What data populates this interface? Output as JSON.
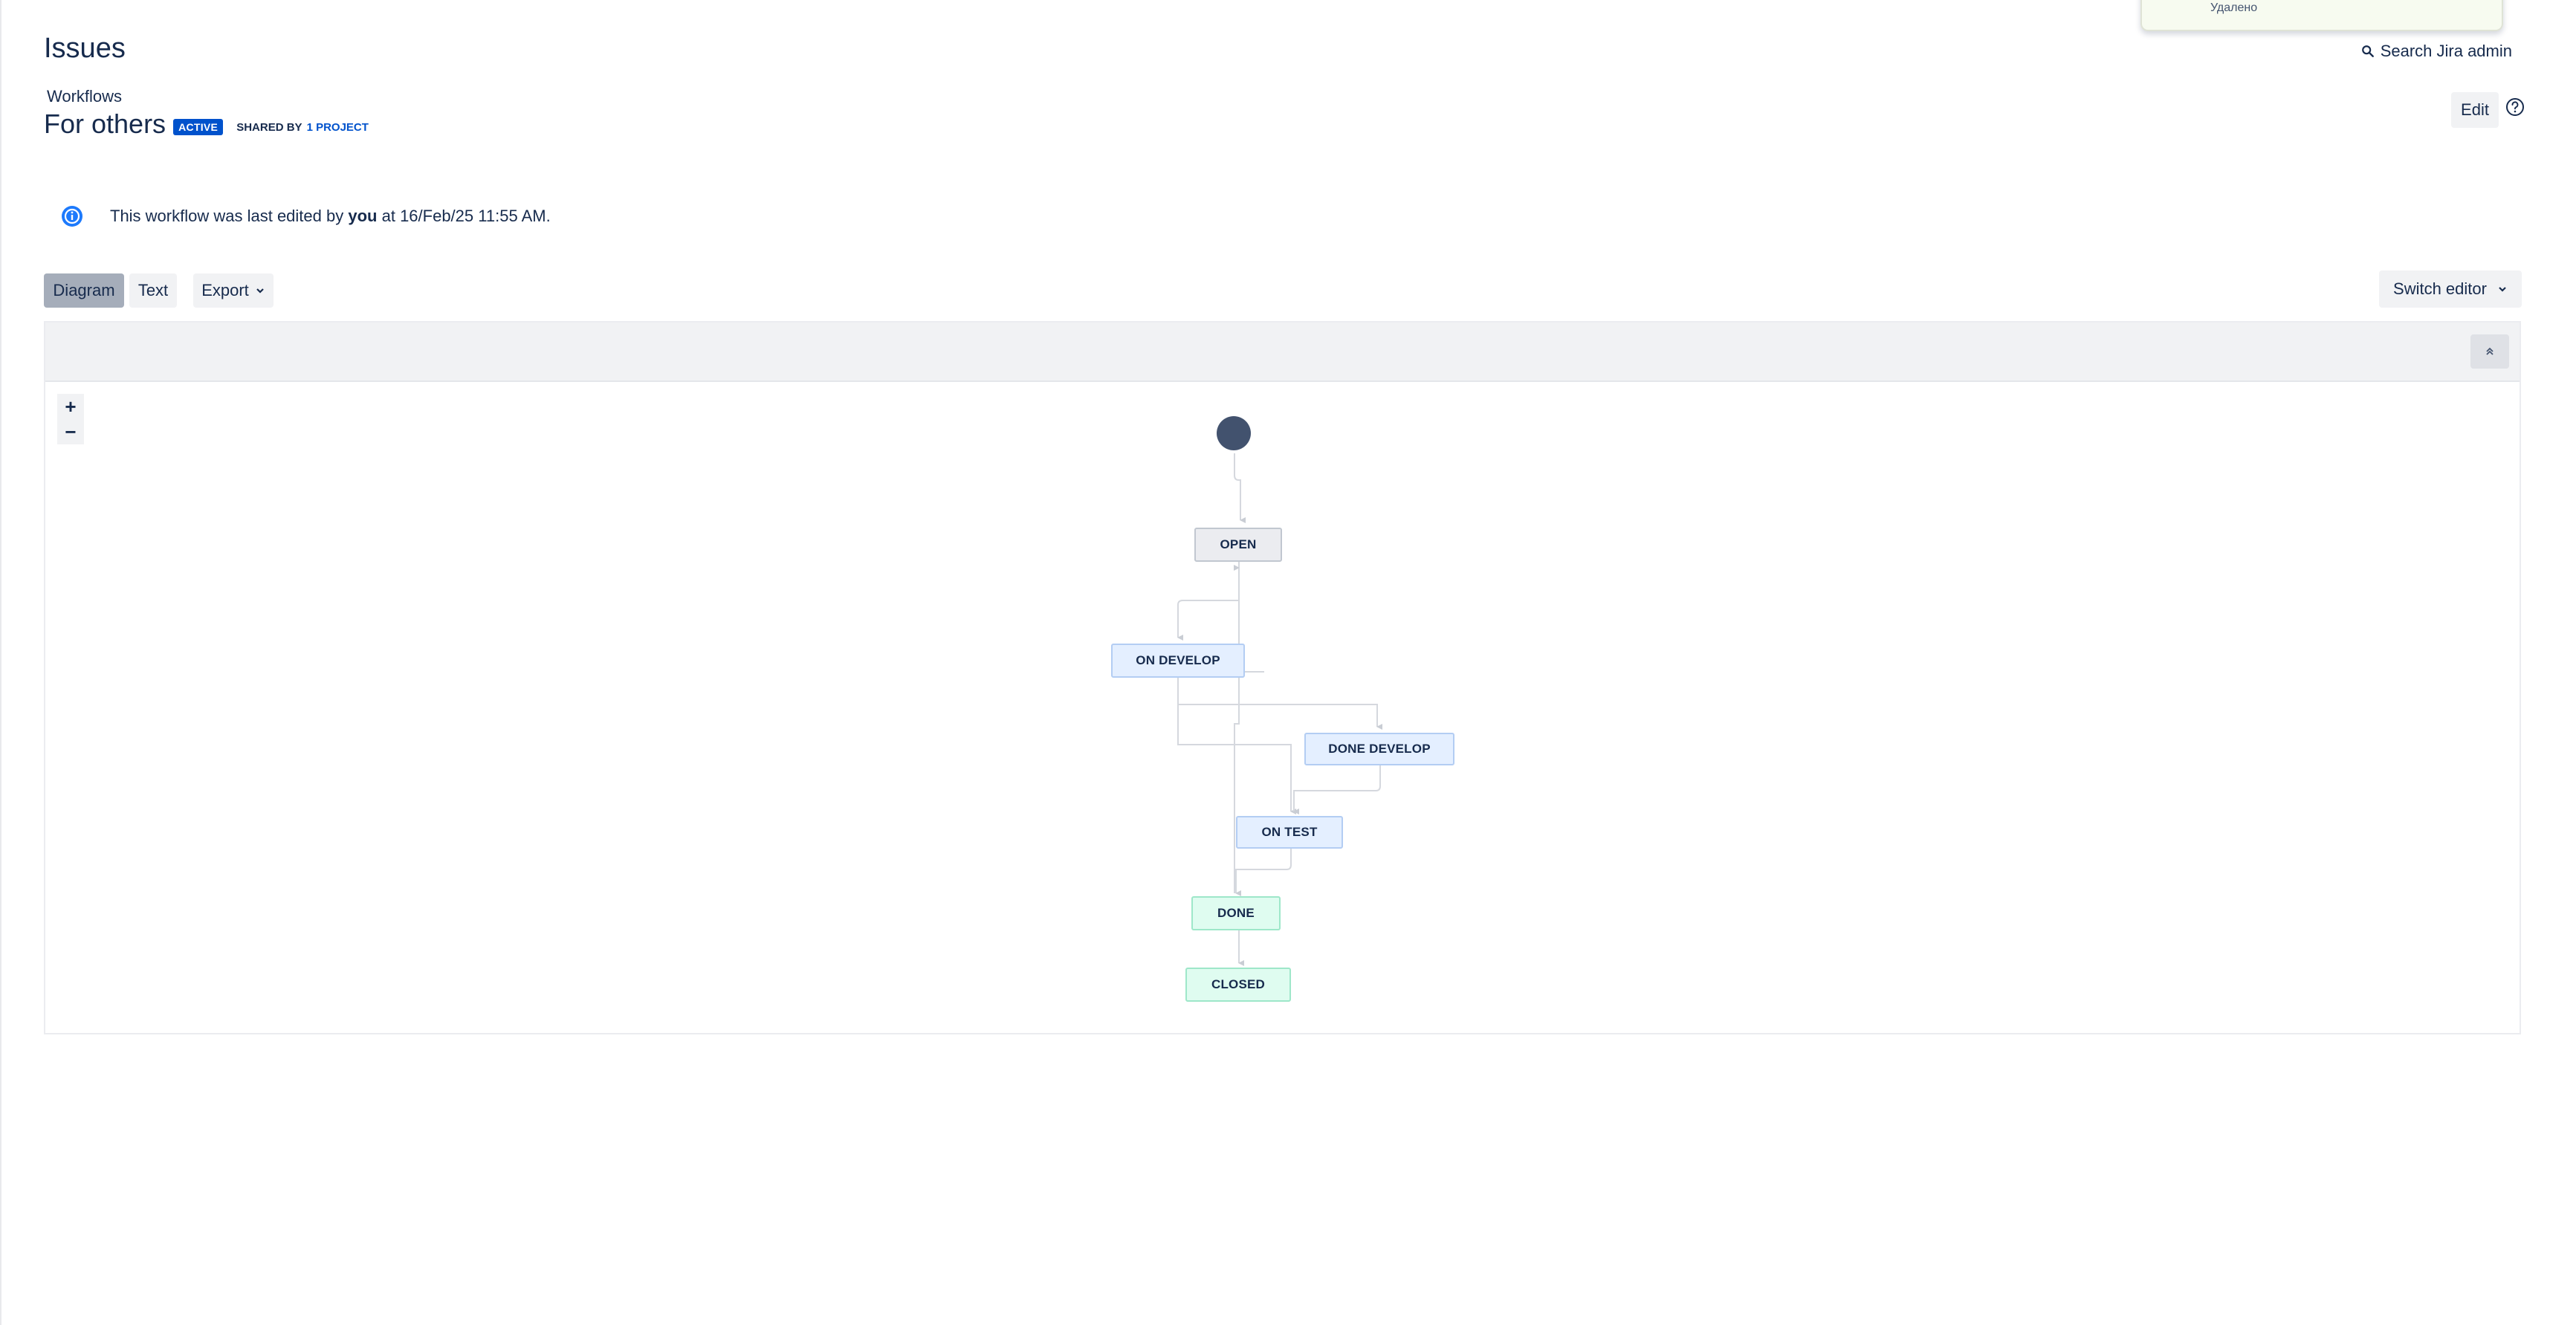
{
  "toast": {
    "text": "Удалено"
  },
  "header": {
    "title": "Issues",
    "search_admin_label": "Search Jira admin"
  },
  "workflow": {
    "breadcrumb": "Workflows",
    "name": "For others",
    "status_lozenge": "ACTIVE",
    "shared_by_label": "SHARED BY",
    "shared_by_link": "1 PROJECT",
    "edit_label": "Edit"
  },
  "info_message": {
    "prefix": "This workflow was last edited by",
    "user": "you",
    "suffix": "at 16/Feb/25 11:55 AM."
  },
  "view_tabs": {
    "diagram": "Diagram",
    "text": "Text",
    "export": "Export",
    "switch_editor": "Switch editor"
  },
  "zoom": {
    "in": "+",
    "out": "−"
  },
  "statuses": [
    {
      "id": "open",
      "label": "OPEN",
      "category": "todo"
    },
    {
      "id": "on_develop",
      "label": "ON DEVELOP",
      "category": "progress"
    },
    {
      "id": "done_develop",
      "label": "DONE DEVELOP",
      "category": "progress"
    },
    {
      "id": "on_test",
      "label": "ON TEST",
      "category": "progress"
    },
    {
      "id": "done",
      "label": "DONE",
      "category": "done"
    },
    {
      "id": "closed",
      "label": "CLOSED",
      "category": "done"
    }
  ],
  "colors": {
    "accent": "#0052cc",
    "todo": "#ebecf0",
    "progress": "#e4efff",
    "done": "#dffcf0",
    "start_node": "#42526e"
  }
}
